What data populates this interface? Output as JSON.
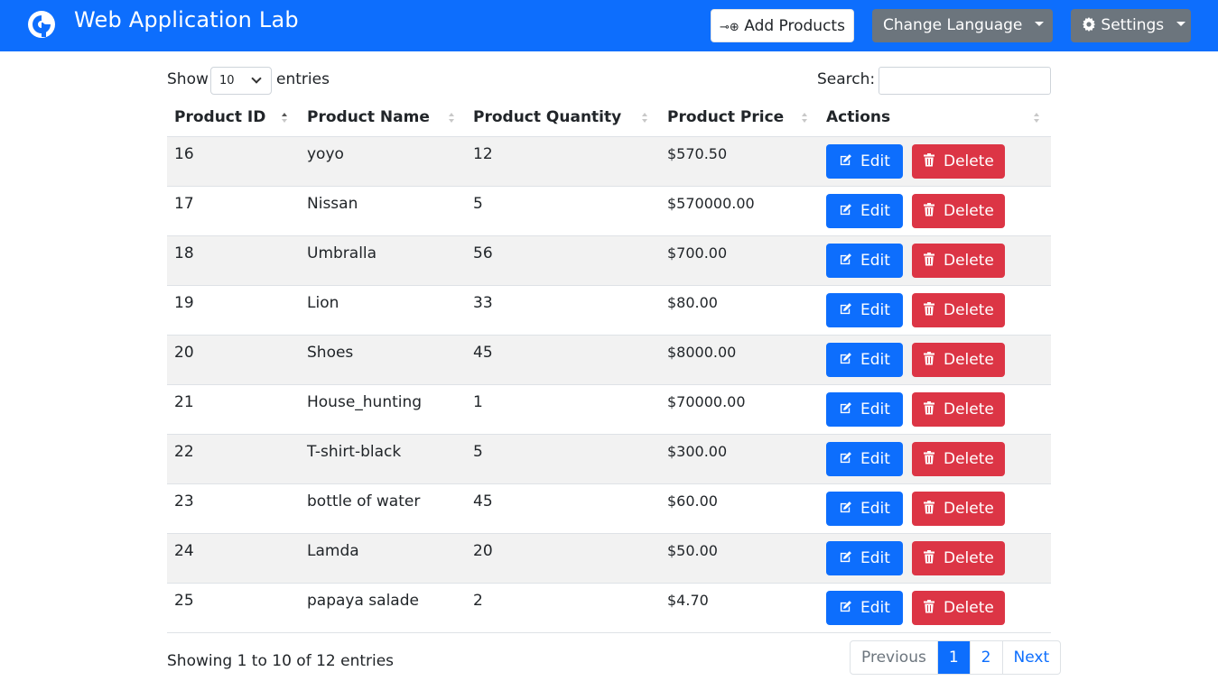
{
  "navbar": {
    "brand_title": "Web Application Lab",
    "add_products_label": "Add Products",
    "change_language_label": "Change Language",
    "settings_label": "Settings",
    "brand_color": "#0d6efd"
  },
  "controls": {
    "show_label": "Show",
    "length_value": "10",
    "entries_label": "entries",
    "search_label": "Search:",
    "search_value": ""
  },
  "table": {
    "columns": [
      "Product ID",
      "Product Name",
      "Product Quantity",
      "Product Price",
      "Actions"
    ],
    "sorted_column": "Product ID",
    "edit_label": "Edit",
    "delete_label": "Delete",
    "rows": [
      {
        "id": "16",
        "name": "yoyo",
        "quantity": "12",
        "price": "$570.50"
      },
      {
        "id": "17",
        "name": "Nissan",
        "quantity": "5",
        "price": "$570000.00"
      },
      {
        "id": "18",
        "name": "Umbralla",
        "quantity": "56",
        "price": "$700.00"
      },
      {
        "id": "19",
        "name": "Lion",
        "quantity": "33",
        "price": "$80.00"
      },
      {
        "id": "20",
        "name": "Shoes",
        "quantity": "45",
        "price": "$8000.00"
      },
      {
        "id": "21",
        "name": "House_hunting",
        "quantity": "1",
        "price": "$70000.00"
      },
      {
        "id": "22",
        "name": "T-shirt-black",
        "quantity": "5",
        "price": "$300.00"
      },
      {
        "id": "23",
        "name": "bottle of water",
        "quantity": "45",
        "price": "$60.00"
      },
      {
        "id": "24",
        "name": "Lamda",
        "quantity": "20",
        "price": "$50.00"
      },
      {
        "id": "25",
        "name": "papaya salade",
        "quantity": "2",
        "price": "$4.70"
      }
    ]
  },
  "footer": {
    "info": "Showing 1 to 10 of 12 entries",
    "pagination": {
      "previous": "Previous",
      "pages": [
        "1",
        "2"
      ],
      "active_page": "1",
      "next": "Next"
    }
  }
}
